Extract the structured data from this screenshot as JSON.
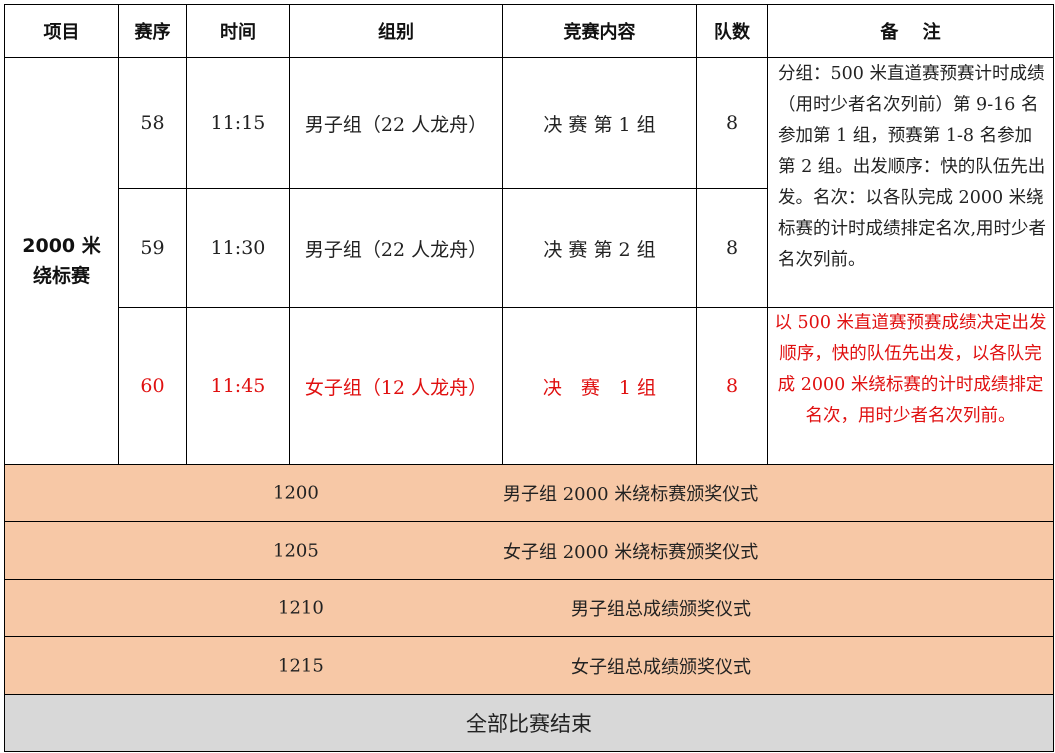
{
  "headers": {
    "project": "项目",
    "seq": "赛序",
    "time": "时间",
    "group": "组别",
    "content": "竞赛内容",
    "teams": "队数",
    "remarks": "备 注"
  },
  "project_name": "2000 米绕标赛",
  "races": [
    {
      "seq": "58",
      "time": "11:15",
      "group": "男子组（22 人龙舟）",
      "content": "决 赛 第 1 组",
      "teams": "8"
    },
    {
      "seq": "59",
      "time": "11:30",
      "group": "男子组（22 人龙舟）",
      "content": "决 赛 第 2 组",
      "teams": "8"
    },
    {
      "seq": "60",
      "time": "11:45",
      "group": "女子组（12 人龙舟）",
      "content": "决　赛　1 组",
      "teams": "8"
    }
  ],
  "remarks_men": "分组：500 米直道赛预赛计时成绩（用时少者名次列前）第 9-16 名参加第 1 组，预赛第 1-8 名参加第 2 组。出发顺序：快的队伍先出发。名次：以各队完成 2000 米绕标赛的计时成绩排定名次,用时少者名次列前。",
  "remarks_women": "以 500 米直道赛预赛成绩决定出发顺序，快的队伍先出发，以各队完成 2000 米绕标赛的计时成绩排定名次，用时少者名次列前。",
  "ceremonies": [
    {
      "time": "1200",
      "title": "男子组 2000 米绕标赛颁奖仪式"
    },
    {
      "time": "1205",
      "title": "女子组 2000 米绕标赛颁奖仪式"
    },
    {
      "time": "1210",
      "title": "男子组总成绩颁奖仪式"
    },
    {
      "time": "1215",
      "title": "女子组总成绩颁奖仪式"
    }
  ],
  "footer": "全部比赛结束",
  "colors": {
    "highlight_text": "#e01010",
    "ceremony_band": "#f7c8a6",
    "footer_band": "#d8d8d8"
  }
}
